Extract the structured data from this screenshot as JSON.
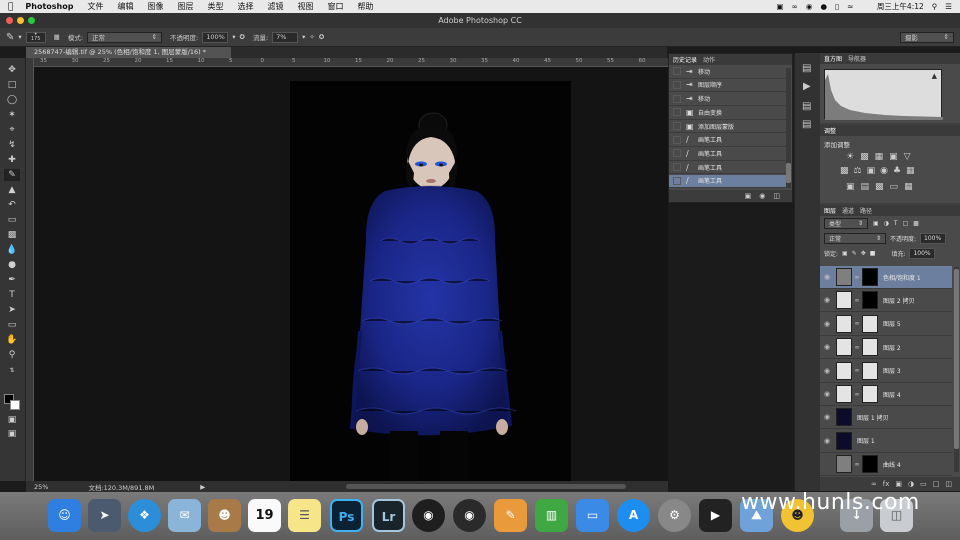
{
  "menubar": {
    "app": "Photoshop",
    "items": [
      "文件",
      "编辑",
      "图像",
      "图层",
      "类型",
      "选择",
      "滤镜",
      "视图",
      "窗口",
      "帮助"
    ],
    "clock": "周三上午4:12"
  },
  "window": {
    "title": "Adobe Photoshop CC"
  },
  "options": {
    "brush_size": "175",
    "mode_label": "模式:",
    "mode_value": "正常",
    "opacity_label": "不透明度:",
    "opacity_value": "100%",
    "flow_label": "流量:",
    "flow_value": "7%",
    "workspace": "摄影"
  },
  "document": {
    "tab_title": "2568747-编辑.tif @ 25% (色相/饱和度 1, 图层蒙版/16) *",
    "zoom": "25%",
    "doc_size": "文档:120.3M/891.8M"
  },
  "ruler_labels": [
    "35",
    "30",
    "25",
    "20",
    "15",
    "10",
    "5",
    "0",
    "5",
    "10",
    "15",
    "20",
    "25",
    "30",
    "35",
    "40",
    "45",
    "50",
    "55",
    "60"
  ],
  "history_panel": {
    "tabs": [
      "历史记录",
      "动作"
    ],
    "items": [
      {
        "label": "移动",
        "icon": "move-icon"
      },
      {
        "label": "图层顺序",
        "icon": "layer-order-icon"
      },
      {
        "label": "移动",
        "icon": "move-icon"
      },
      {
        "label": "自由变换",
        "icon": "transform-icon"
      },
      {
        "label": "添加图层蒙版",
        "icon": "mask-icon"
      },
      {
        "label": "画笔工具",
        "icon": "brush-icon"
      },
      {
        "label": "画笔工具",
        "icon": "brush-icon"
      },
      {
        "label": "画笔工具",
        "icon": "brush-icon"
      },
      {
        "label": "画笔工具",
        "icon": "brush-icon"
      }
    ],
    "selected_index": 8
  },
  "histogram_panel": {
    "tabs": [
      "直方图",
      "导航器"
    ]
  },
  "adjustments_panel": {
    "tab": "调整",
    "title": "添加调整"
  },
  "layers_panel": {
    "tabs": [
      "图层",
      "通道",
      "路径"
    ],
    "filter": "类型",
    "blend": "正常",
    "opacity_label": "不透明度:",
    "opacity_value": "100%",
    "lock_label": "锁定:",
    "fill_label": "填充:",
    "fill_value": "100%",
    "layers": [
      {
        "name": "色相/饱和度 1",
        "thumb": "adj",
        "mask": "blk",
        "selected": true
      },
      {
        "name": "图层 2 拷贝",
        "thumb": "light",
        "mask": "blk",
        "selected": false
      },
      {
        "name": "图层 5",
        "thumb": "light",
        "mask": "light",
        "selected": false
      },
      {
        "name": "图层 2",
        "thumb": "light",
        "mask": "light",
        "selected": false
      },
      {
        "name": "图层 3",
        "thumb": "light",
        "mask": "light",
        "selected": false
      },
      {
        "name": "图层 4",
        "thumb": "light",
        "mask": "light",
        "selected": false
      },
      {
        "name": "图层 1 拷贝",
        "thumb": "dark",
        "mask": null,
        "selected": false
      },
      {
        "name": "图层 1",
        "thumb": "dark",
        "mask": null,
        "selected": false
      },
      {
        "name": "曲线 4",
        "thumb": "adj",
        "mask": "blk",
        "selected": false
      }
    ]
  },
  "dock": {
    "calendar_day": "19",
    "items": [
      "finder",
      "launchpad",
      "safari",
      "mail",
      "contacts",
      "calendar",
      "notes",
      "photoshop",
      "lightroom",
      "onepassword",
      "photo-booth",
      "pages",
      "numbers",
      "keynote",
      "app-store",
      "system-preferences",
      "final-cut",
      "iphoto",
      "qq",
      "downloads",
      "trash"
    ],
    "ps_label": "Ps",
    "lr_label": "Lr"
  },
  "watermark": "www.hunls.com",
  "colors": {
    "accent": "#3b78d8",
    "fur": "#1b2a88",
    "panel": "#4a4a4a",
    "selected_row": "#6d7f9e"
  }
}
